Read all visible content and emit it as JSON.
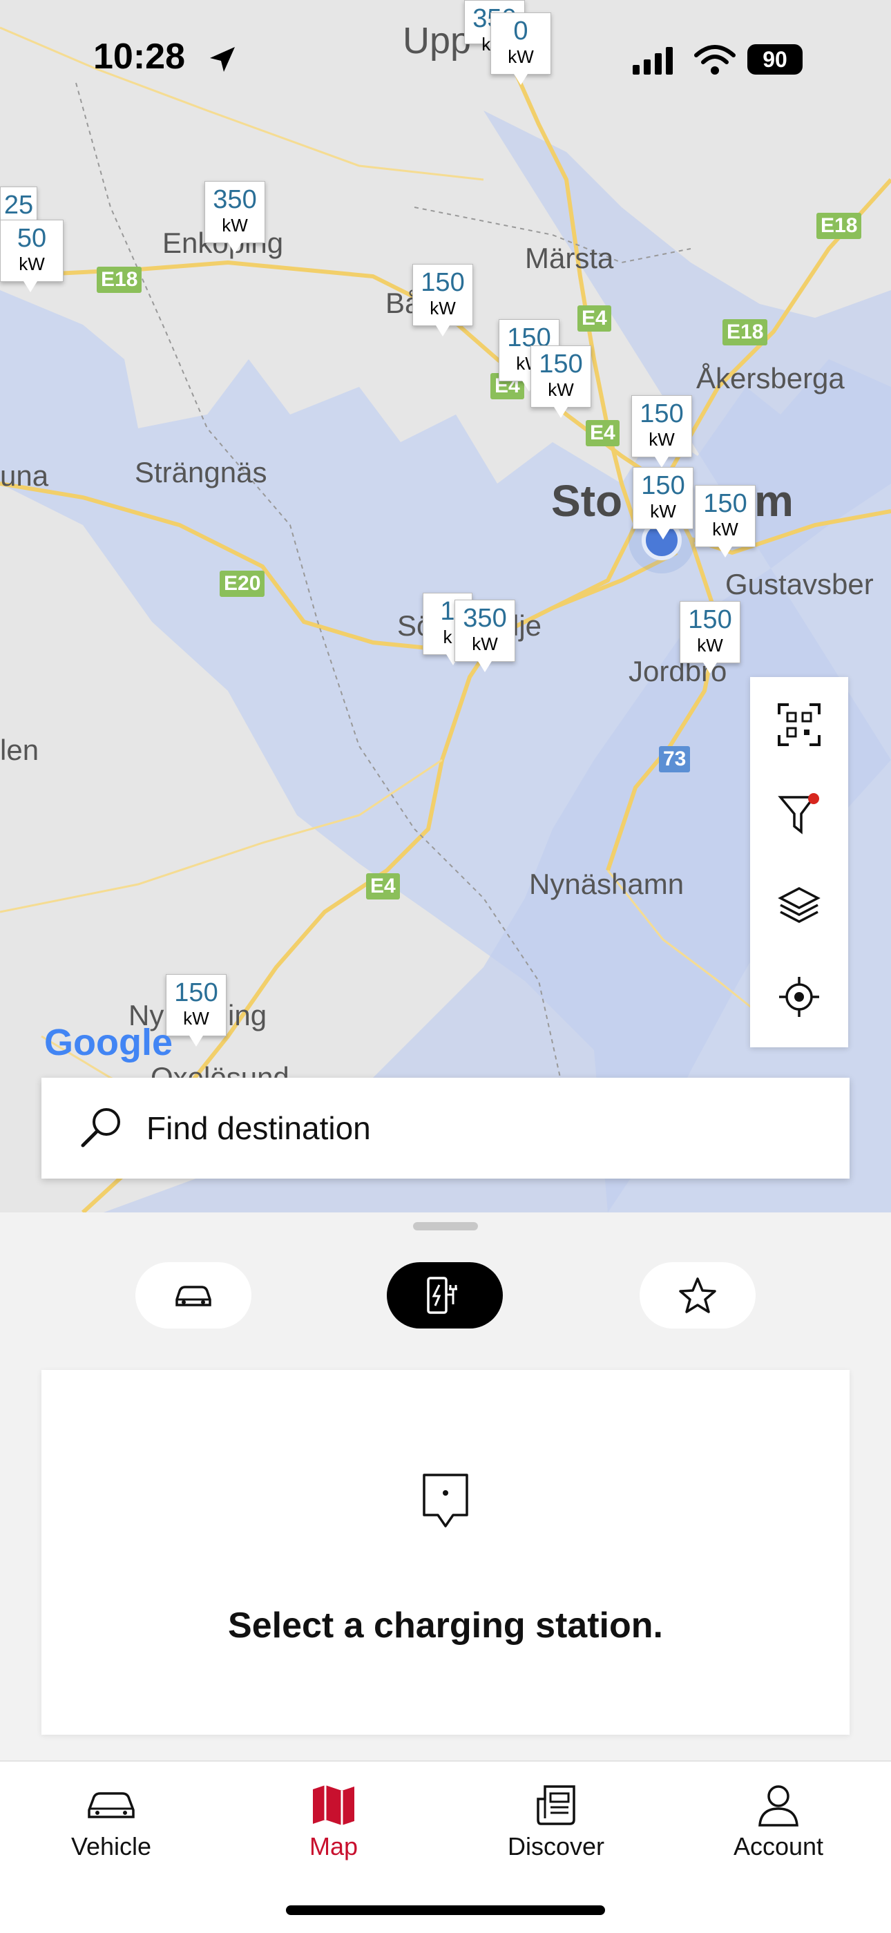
{
  "status_bar": {
    "time": "10:28",
    "battery": "90"
  },
  "map": {
    "places": [
      "Upp",
      "Enköping",
      "Märsta",
      "Bå",
      "Åkersberga",
      "Strängnäs",
      "una",
      "Sto",
      "m",
      "Gustavsber",
      "Sö",
      "lje",
      "Jordbro",
      "len",
      "Nynäshamn",
      "Ny",
      "ing",
      "Oxelösund"
    ],
    "roads": [
      "E18",
      "E18",
      "E18",
      "E4",
      "E4",
      "E4",
      "E20",
      "E4",
      "73"
    ],
    "markers": [
      {
        "value": "350",
        "unit": "kW"
      },
      {
        "value": "0",
        "unit": "kW"
      },
      {
        "value": "25",
        "unit": "W"
      },
      {
        "value": "50",
        "unit": "kW"
      },
      {
        "value": "350",
        "unit": "kW"
      },
      {
        "value": "150",
        "unit": "kW"
      },
      {
        "value": "150",
        "unit": "kW"
      },
      {
        "value": "150",
        "unit": "kW"
      },
      {
        "value": "150",
        "unit": "kW"
      },
      {
        "value": "150",
        "unit": "kW"
      },
      {
        "value": "150",
        "unit": "kW"
      },
      {
        "value": "1",
        "unit": "k"
      },
      {
        "value": "350",
        "unit": "kW"
      },
      {
        "value": "150",
        "unit": "kW"
      },
      {
        "value": "150",
        "unit": "kW"
      }
    ],
    "google_logo": "Google",
    "tools": [
      "qr-scan",
      "filter",
      "layers",
      "locate"
    ]
  },
  "search": {
    "placeholder": "Find destination"
  },
  "sheet": {
    "modes": [
      "car",
      "charging",
      "favorites"
    ],
    "card_message": "Select a charging station."
  },
  "tabs": [
    {
      "label": "Vehicle"
    },
    {
      "label": "Map"
    },
    {
      "label": "Discover"
    },
    {
      "label": "Account"
    }
  ],
  "colors": {
    "accent": "#c8102e",
    "kw_value": "#2a6f97",
    "road_sign": "#8bbf5a"
  }
}
